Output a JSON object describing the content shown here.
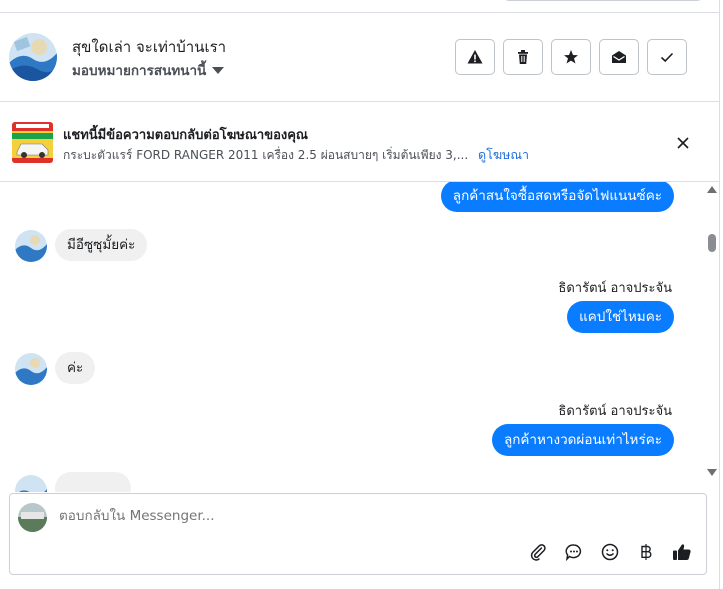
{
  "header": {
    "name": "สุขใดเล่า จะเท่าบ้านเรา",
    "assign_label": "มอบหมายการสนทนานี้"
  },
  "actions": [
    {
      "name": "report",
      "icon": "warning-icon"
    },
    {
      "name": "delete",
      "icon": "trash-icon"
    },
    {
      "name": "star",
      "icon": "star-icon"
    },
    {
      "name": "mark-unread",
      "icon": "envelope-open-icon"
    },
    {
      "name": "mark-done",
      "icon": "check-icon"
    }
  ],
  "ad": {
    "title": "แชทนี้มีข้อความตอบกลับต่อโฆษณาของคุณ",
    "description": "กระบะตัวแรร์ FORD RANGER 2011 เครื่อง 2.5 ผ่อนสบายๆ เริ่มต้นเพียง 3,...",
    "link_label": "ดูโฆษณา"
  },
  "messages": [
    {
      "direction": "out",
      "text": "ลูกค้าสนใจซื้อสดหรือจัดไฟแนนซ์คะ"
    },
    {
      "direction": "in",
      "text": "มีอีซูซุมั้ยค่ะ"
    },
    {
      "direction": "out",
      "sender": "ธิดารัตน์ อาจประจัน",
      "text": "แคปใช่ไหมคะ"
    },
    {
      "direction": "in",
      "text": "ค่ะ"
    },
    {
      "direction": "out",
      "sender": "ธิดารัตน์ อาจประจัน",
      "text": "ลูกค้าหางวดผ่อนเท่าไหร่คะ"
    }
  ],
  "composer": {
    "placeholder": "ตอบกลับใน Messenger..."
  },
  "composer_tools": [
    "paperclip-icon",
    "speech-bubble-icon",
    "smiley-icon",
    "baht-icon",
    "thumbs-up-icon"
  ],
  "colors": {
    "accent": "#0a7cff",
    "link": "#216fdb",
    "incoming_bubble": "#f0f0f0"
  }
}
